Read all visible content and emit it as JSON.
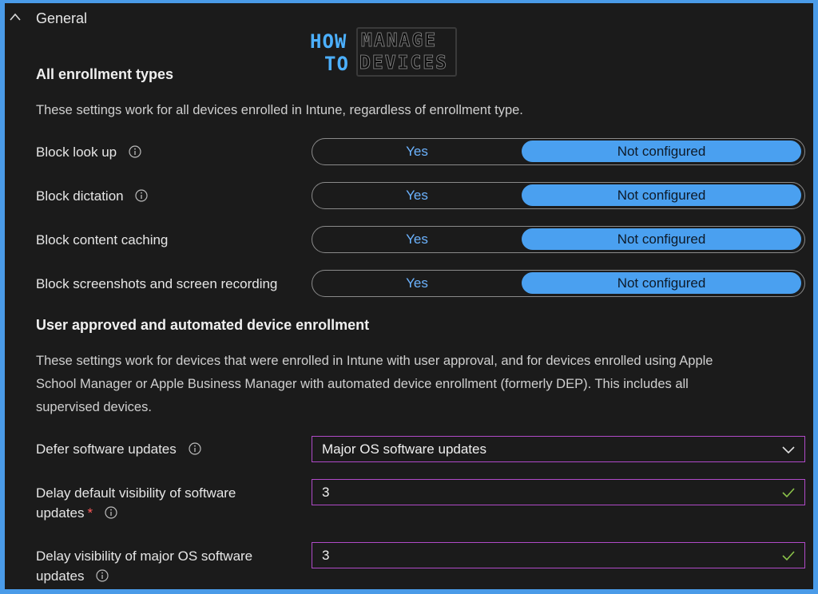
{
  "section": {
    "title": "General",
    "expanded": true
  },
  "logo": {
    "how": "HOW",
    "to": "TO",
    "manage": "MANAGE",
    "devices": "DEVICES"
  },
  "all_enrollment": {
    "heading": "All enrollment types",
    "description": "These settings work for all devices enrolled in Intune, regardless of enrollment type.",
    "settings": [
      {
        "label": "Block look up",
        "has_info": true,
        "yes_label": "Yes",
        "nc_label": "Not configured",
        "selected": "Not configured"
      },
      {
        "label": "Block dictation",
        "has_info": true,
        "yes_label": "Yes",
        "nc_label": "Not configured",
        "selected": "Not configured"
      },
      {
        "label": "Block content caching",
        "has_info": false,
        "yes_label": "Yes",
        "nc_label": "Not configured",
        "selected": "Not configured"
      },
      {
        "label": "Block screenshots and screen recording",
        "has_info": false,
        "yes_label": "Yes",
        "nc_label": "Not configured",
        "selected": "Not configured"
      }
    ]
  },
  "user_approved": {
    "heading": "User approved and automated device enrollment",
    "description_line1": "These settings work for devices that were enrolled in Intune with user approval, and for devices enrolled using Apple",
    "description_line2": "School Manager or Apple Business Manager with automated device enrollment (formerly DEP). This includes all",
    "description_line3": "supervised devices.",
    "defer": {
      "label": "Defer software updates",
      "value": "Major OS software updates"
    },
    "delay_default": {
      "label_line1": "Delay default visibility of software",
      "label_line2": "updates",
      "required_mark": "*",
      "value": "3"
    },
    "delay_major": {
      "label_line1": "Delay visibility of major OS software",
      "label_line2": "updates",
      "value": "3"
    }
  },
  "colors": {
    "accent": "#4aa0f0",
    "field_border": "#b04ac8",
    "valid_check": "#8bc34a",
    "background": "#1b1b1b",
    "frame": "#4a9be8"
  }
}
